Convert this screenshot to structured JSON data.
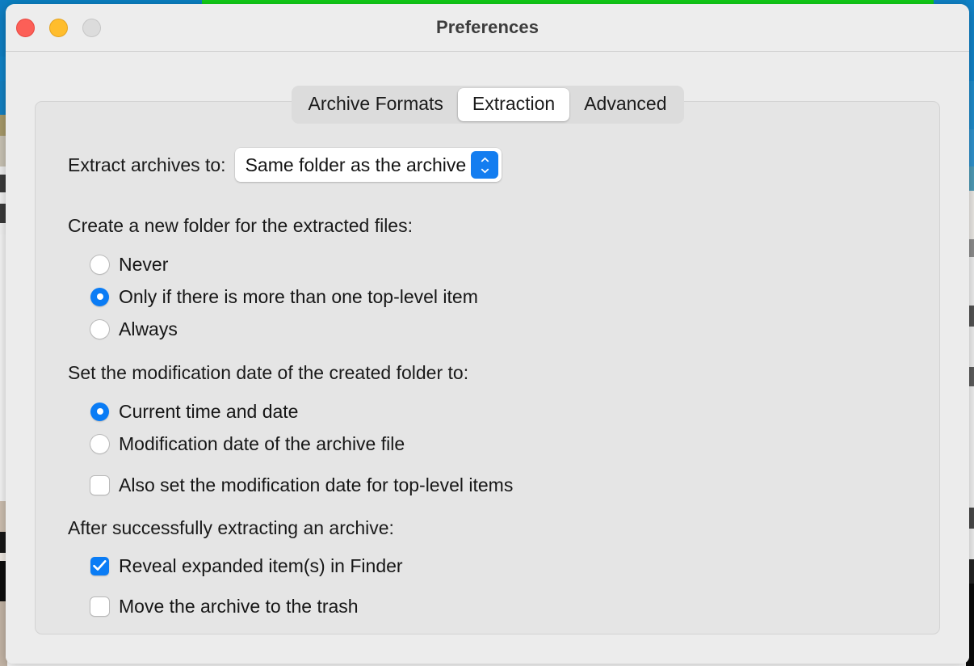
{
  "window": {
    "title": "Preferences",
    "traffic_lights": [
      {
        "name": "close",
        "color": "#fc5f57"
      },
      {
        "name": "minimize",
        "color": "#ffbd2d"
      },
      {
        "name": "zoom",
        "color": "#dcdcdc"
      }
    ]
  },
  "tabs": [
    {
      "id": "archive-formats",
      "label": "Archive Formats",
      "active": false
    },
    {
      "id": "extraction",
      "label": "Extraction",
      "active": true
    },
    {
      "id": "advanced",
      "label": "Advanced",
      "active": false
    }
  ],
  "extraction": {
    "extract_to": {
      "label": "Extract archives to:",
      "value": "Same folder as the archive",
      "options": [
        "Same folder as the archive"
      ]
    },
    "new_folder": {
      "heading": "Create a new folder for the extracted files:",
      "options": [
        {
          "id": "never",
          "label": "Never",
          "selected": false
        },
        {
          "id": "only-if-more",
          "label": "Only if there is more than one top-level item",
          "selected": true
        },
        {
          "id": "always",
          "label": "Always",
          "selected": false
        }
      ]
    },
    "modification_date": {
      "heading": "Set the modification date of the created folder to:",
      "options": [
        {
          "id": "current-time",
          "label": "Current time and date",
          "selected": true
        },
        {
          "id": "archive-date",
          "label": "Modification date of the archive file",
          "selected": false
        }
      ],
      "also_set": {
        "id": "also-set-top-level",
        "label": "Also set the modification date for top-level items",
        "checked": false
      }
    },
    "after_extract": {
      "heading": "After successfully extracting an archive:",
      "checkboxes": [
        {
          "id": "reveal-in-finder",
          "label": "Reveal expanded item(s) in Finder",
          "checked": true
        },
        {
          "id": "move-to-trash",
          "label": "Move the archive to the trash",
          "checked": false
        }
      ]
    }
  },
  "colors": {
    "accent": "#0a7cf5",
    "window_bg": "#ececec",
    "panel_bg": "#e5e5e5",
    "tabbar_bg": "#dcdcdc"
  }
}
